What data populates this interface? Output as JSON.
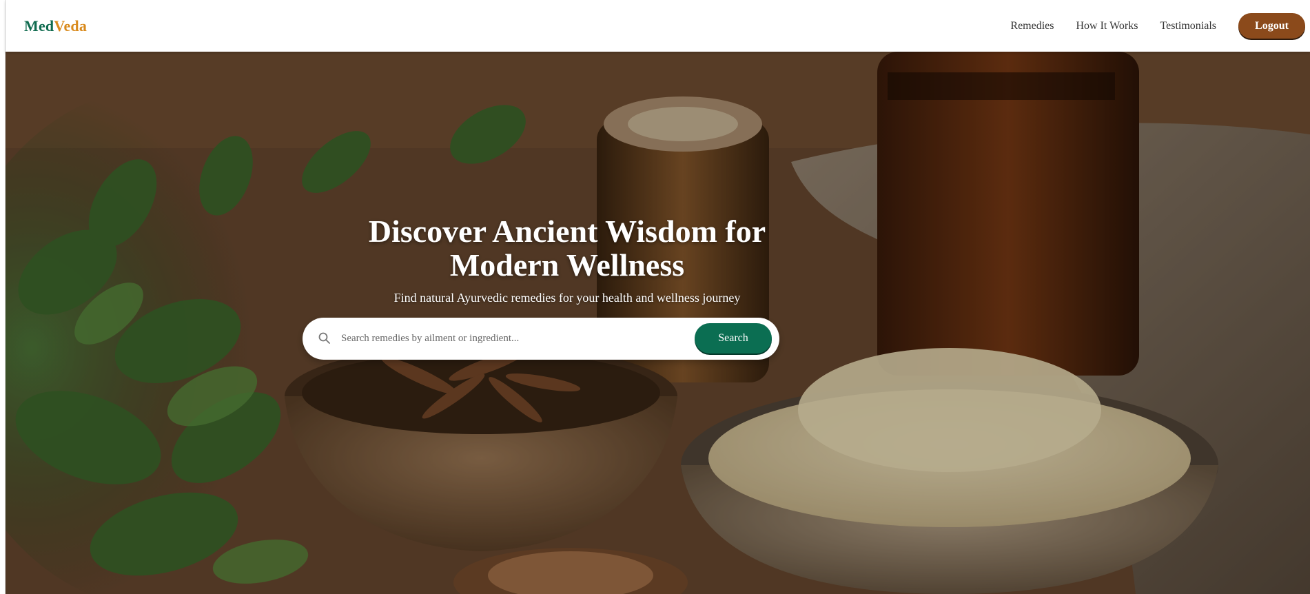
{
  "brand": {
    "part1": "Med",
    "part2": "Veda"
  },
  "nav": {
    "links": [
      "Remedies",
      "How It Works",
      "Testimonials"
    ],
    "logout_label": "Logout"
  },
  "hero": {
    "title_line1": "Discover Ancient Wisdom for",
    "title_line2": "Modern Wellness",
    "subtitle": "Find natural Ayurvedic remedies for your health and wellness journey",
    "search": {
      "placeholder": "Search remedies by ailment or ingredient...",
      "value": "",
      "button_label": "Search",
      "icon": "search-icon"
    }
  },
  "colors": {
    "brand_green": "#0f6b4f",
    "brand_orange": "#d98a1c",
    "logout_brown": "#8b4a1b",
    "search_green": "#0b6e52"
  }
}
